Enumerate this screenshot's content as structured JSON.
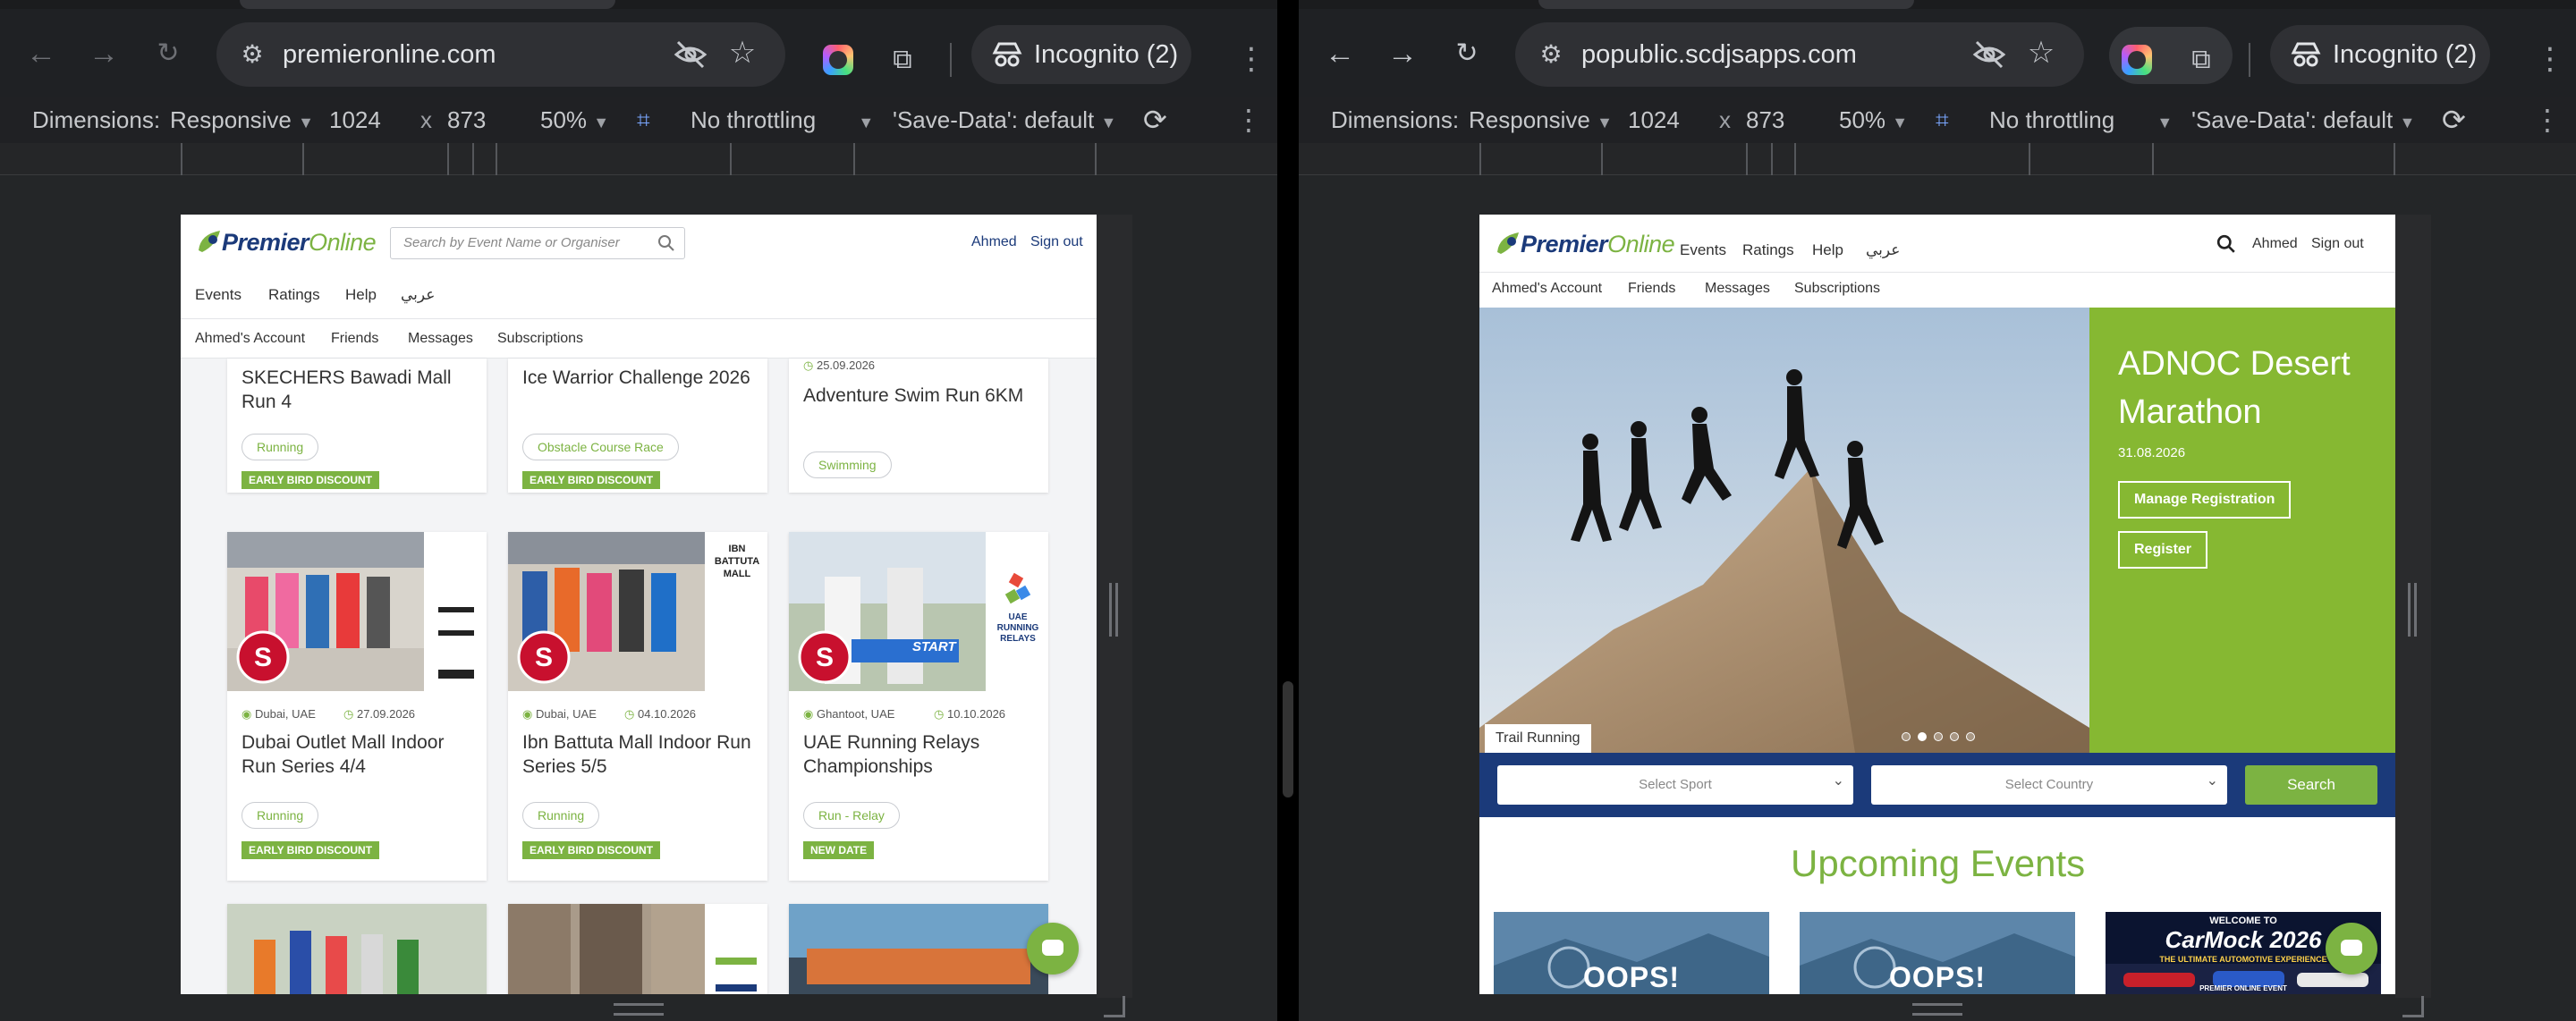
{
  "colors": {
    "brand_navy": "#1b3a7a",
    "brand_green": "#7cb342",
    "hero_green": "#86b832",
    "chrome_bg": "#1f2124",
    "omnibox_bg": "#2f3034"
  },
  "left_window": {
    "url": "premieronline.com",
    "incognito": "Incognito (2)",
    "icons": [
      "back-icon",
      "forward-icon",
      "reload-icon",
      "tune-icon",
      "eye-off-icon",
      "star-icon",
      "extension-icon",
      "puzzle-icon",
      "incognito-icon",
      "more-icon"
    ],
    "devtools": {
      "dimensions_label": "Dimensions:",
      "mode": "Responsive",
      "width": "1024",
      "times": "x",
      "height": "873",
      "zoom": "50%",
      "throttling": "No throttling",
      "save_data": "'Save-Data': default"
    },
    "page": {
      "logo_premier": "Premier",
      "logo_online": "Online",
      "search_placeholder": "Search by Event Name or Organiser",
      "user": "Ahmed",
      "signout": "Sign out",
      "nav": [
        "Events",
        "Ratings",
        "Help",
        "عربي"
      ],
      "subnav": [
        "Ahmed's Account",
        "Friends",
        "Messages",
        "Subscriptions"
      ],
      "row1": [
        {
          "title": "SKECHERS Bawadi Mall Run 4",
          "tag": "Running",
          "badge": "EARLY BIRD DISCOUNT"
        },
        {
          "title": "Ice Warrior Challenge 2026",
          "tag": "Obstacle Course Race",
          "badge": "EARLY BIRD DISCOUNT"
        },
        {
          "date": "25.09.2026",
          "title": "Adventure Swim Run 6KM",
          "tag": "Swimming"
        }
      ],
      "row2": [
        {
          "location": "Dubai, UAE",
          "date": "27.09.2026",
          "title": "Dubai Outlet Mall Indoor Run Series 4/4",
          "tag": "Running",
          "badge": "EARLY BIRD DISCOUNT"
        },
        {
          "location": "Dubai, UAE",
          "date": "04.10.2026",
          "title": "Ibn Battuta Mall Indoor Run Series 5/5",
          "tag": "Running",
          "badge": "EARLY BIRD DISCOUNT",
          "sponsor": "IBN BATTUTA MALL"
        },
        {
          "location": "Ghantoot, UAE",
          "date": "10.10.2026",
          "title": "UAE Running Relays Championships",
          "tag": "Run - Relay",
          "badge": "NEW DATE",
          "sponsor": "UAE RUNNING RELAYS",
          "banner": "START"
        }
      ]
    }
  },
  "right_window": {
    "url": "popublic.scdjsapps.com",
    "incognito": "Incognito (2)",
    "devtools": {
      "dimensions_label": "Dimensions:",
      "mode": "Responsive",
      "width": "1024",
      "times": "x",
      "height": "873",
      "zoom": "50%",
      "throttling": "No throttling",
      "save_data": "'Save-Data': default"
    },
    "page": {
      "logo_premier": "Premier",
      "logo_online": "Online",
      "nav": [
        "Events",
        "Ratings",
        "Help",
        "عربي"
      ],
      "user": "Ahmed",
      "signout": "Sign out",
      "subnav": [
        "Ahmed's Account",
        "Friends",
        "Messages",
        "Subscriptions"
      ],
      "hero": {
        "title": "ADNOC Desert Marathon",
        "date": "31.08.2026",
        "manage": "Manage Registration",
        "register": "Register",
        "category": "Trail Running",
        "slides": 5,
        "active_slide": 2
      },
      "filters": {
        "sport": "Select Sport",
        "country": "Select Country",
        "search": "Search"
      },
      "upcoming": "Upcoming Events",
      "upcoming_cards": [
        {
          "text": "OOPS!"
        },
        {
          "text": "OOPS!"
        },
        {
          "text": "WELCOME TO",
          "title": "CarMock 2026",
          "sub": "THE ULTIMATE AUTOMOTIVE EXPERIENCE",
          "foot": "PREMIER ONLINE EVENT"
        }
      ]
    }
  }
}
